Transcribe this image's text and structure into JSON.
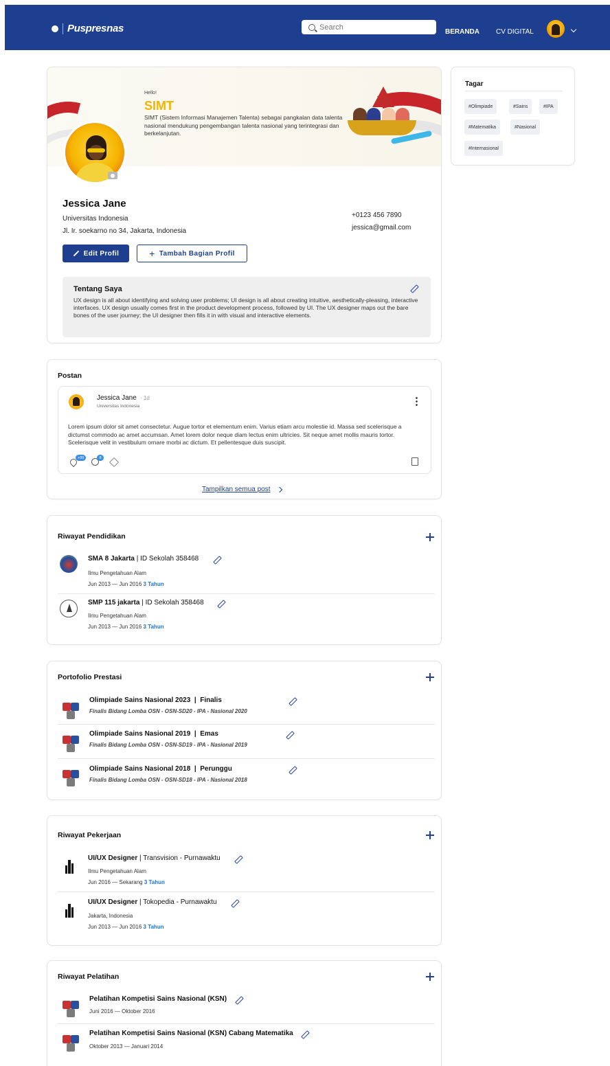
{
  "header": {
    "logo_text": "Puspresnas",
    "search_placeholder": "Search",
    "nav": [
      "BERANDA",
      "CV DIGITAL"
    ]
  },
  "banner": {
    "hello": "Hello!",
    "title": "SIMT",
    "description": "SIMT (Sistem Informasi Manajemen Talenta) sebagai pangkalan data talenta nasional mendukung pengembangan talenta nasional yang terintegrasi dan berkelanjutan."
  },
  "profile": {
    "name": "Jessica Jane",
    "university": "Universitas Indonesia",
    "address": "Jl. Ir. soekarno no 34, Jakarta, Indonesia",
    "phone": "+0123 456 7890",
    "email": "jessica@gmail.com",
    "edit_button": "Edit Profil",
    "add_section_button": "Tambah Bagian Profil"
  },
  "about": {
    "title": "Tentang Saya",
    "text": "UX design is all about identifying and solving user problems; UI design is all about creating intuitive, aesthetically-pleasing, interactive interfaces. UX design usually comes first in the product development process, followed by UI. The UX designer maps out the bare bones of the user journey; the UI designer then fills it in with visual and interactive elements."
  },
  "tags": {
    "title": "Tagar",
    "items": [
      "#Olimpiade",
      "#Sains",
      "#IPA",
      "#Matematika",
      "#Nasional",
      "#Internasional"
    ]
  },
  "posts": {
    "title": "Postan",
    "author": "Jessica Jane",
    "time": "· 1d",
    "author_univ": "Universitas Indonesia",
    "body": "Lorem ipsum dolor sit amet consectetur. Augue tortor et elementum enim. Varius etiam arcu molestie id. Massa sed scelerisque a dictumst commodo ac amet accumsan. Amet lorem dolor neque diam lectus enim ultricies. Sit neque amet mollis mauris tortor. Scelerisque velit in vestibulum ornare morbi ac dictum. Et pellentesque duis suscipit.",
    "like_count": "+99",
    "comment_count": "8",
    "show_all": "Tampilkan semua post"
  },
  "education": {
    "title": "Riwayat Pendidikan",
    "items": [
      {
        "school": "SMA 8 Jakarta",
        "sep": " | ",
        "id": "ID Sekolah 358468",
        "major": "Ilmu Pengetahuan Alam",
        "period": "Jun 2013 — Jun 2016",
        "duration": "3 Tahun"
      },
      {
        "school": "SMP 115 jakarta",
        "sep": " | ",
        "id": "ID Sekolah 358468",
        "major": "Ilmu Pengetahuan Alam",
        "period": "Jun 2013 — Jun 2016",
        "duration": "3 Tahun"
      }
    ]
  },
  "achievements": {
    "title": "Portofolio Prestasi",
    "items": [
      {
        "name": "Olimpiade Sains Nasional 2023",
        "sep": "  |  ",
        "rank": "Finalis",
        "detail": "Finalis Bidang Lomba OSN - OSN-SD20 - IPA - Nasional 2020"
      },
      {
        "name": "Olimpiade Sains Nasional 2019",
        "sep": "  |  ",
        "rank": "Emas",
        "detail": "Finalis Bidang Lomba OSN - OSN-SD19 - IPA - Nasional 2019"
      },
      {
        "name": "Olimpiade Sains Nasional 2018",
        "sep": "  |  ",
        "rank": "Perunggu",
        "detail": "Finalis Bidang Lomba OSN - OSN-SD18 - IPA - Nasional 2018"
      }
    ]
  },
  "work": {
    "title": "Riwayat Pekerjaan",
    "items": [
      {
        "role": "UI/UX Designer",
        "sep": " | ",
        "company": "Transvision - Purnawaktu",
        "sub": "Ilmu Pengetahuan Alam",
        "period": "Jun 2016 — Sekarang",
        "duration": "3 Tahun"
      },
      {
        "role": "UI/UX Designer",
        "sep": " | ",
        "company": "Tokopedia - Purnawaktu",
        "sub": "Jakarta, Indonesia",
        "period": "Jun 2013 — Jun 2016",
        "duration": "3 Tahun"
      }
    ]
  },
  "training": {
    "title": "Riwayat Pelatihan",
    "items": [
      {
        "name": "Pelatihan Kompetisi Sains Nasional (KSN)",
        "period": "Juni 2016 — Oktober 2016"
      },
      {
        "name": "Pelatihan Kompetisi Sains Nasional (KSN) Cabang Matematika",
        "period": "Oktober 2013 — Januari 2014"
      }
    ]
  },
  "colors": {
    "primary": "#1e3f8f",
    "accent_yellow": "#f4b400",
    "duration_blue": "#1976d2"
  }
}
